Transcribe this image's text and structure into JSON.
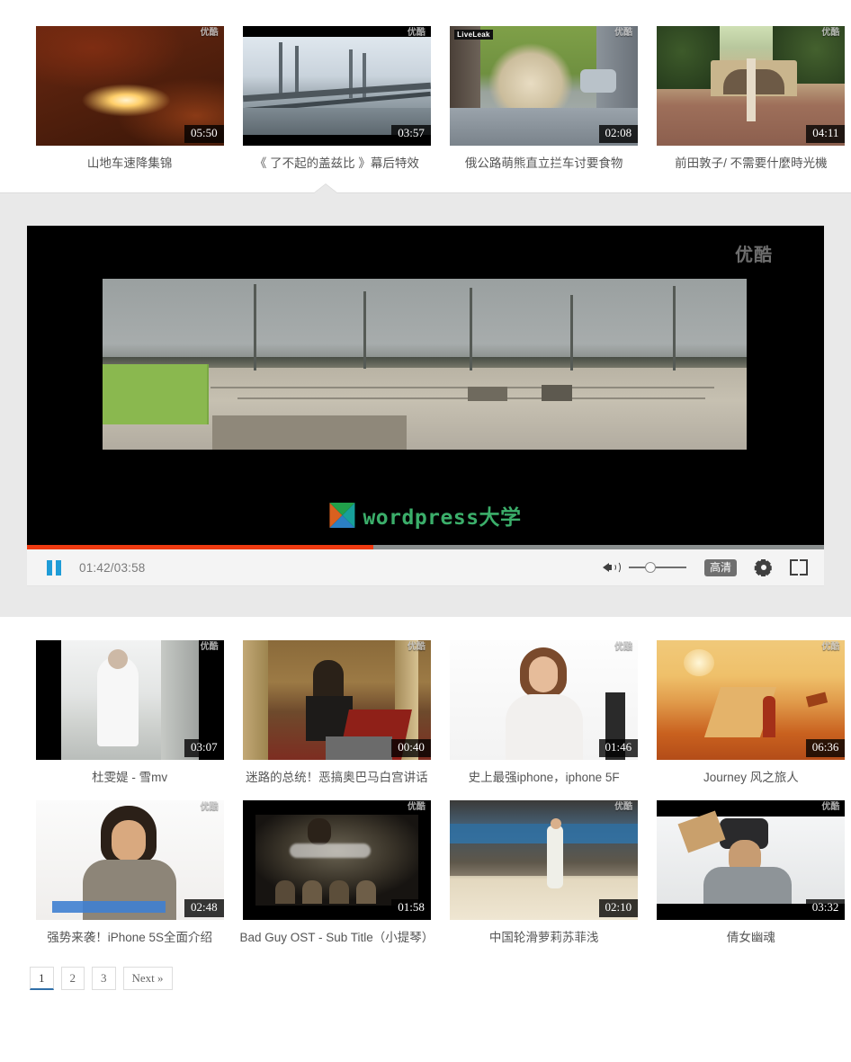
{
  "site": {
    "player_watermark": "优酷",
    "brand_watermark_text": "wordpress大学",
    "thumb_watermark": "优酷",
    "liveleak_badge": "LiveLeak"
  },
  "top_row": [
    {
      "title": "山地车速降集锦",
      "duration": "05:50",
      "watermark": "优酷",
      "active": false
    },
    {
      "title": "《 了不起的盖兹比 》幕后特效",
      "duration": "03:57",
      "watermark": "优酷",
      "active": true
    },
    {
      "title": "俄公路萌熊直立拦车讨要食物",
      "duration": "02:08",
      "watermark": "优酷",
      "badge": "LiveLeak",
      "active": false
    },
    {
      "title": "前田敦子/ 不需要什麼時光機",
      "duration": "04:11",
      "watermark": "优酷",
      "active": false
    }
  ],
  "player": {
    "watermark": "优酷",
    "brand": "wordpress大学",
    "time_display": "01:42/03:58",
    "current_time": "01:42",
    "total_time": "03:58",
    "progress_percent": 43.5,
    "volume_percent": 38,
    "quality_label": "高清",
    "pause_label": "pause",
    "state": "playing"
  },
  "bottom_row_1": [
    {
      "title": "杜雯媞 - 雪mv",
      "duration": "03:07",
      "watermark": "优酷"
    },
    {
      "title": "迷路的总统！恶搞奥巴马白宫讲话",
      "duration": "00:40",
      "watermark": "优酷"
    },
    {
      "title": "史上最强iphone，iphone 5F",
      "duration": "01:46",
      "watermark": "优酷"
    },
    {
      "title": "Journey 风之旅人",
      "duration": "06:36",
      "watermark": "优酷"
    }
  ],
  "bottom_row_2": [
    {
      "title": "强势来袭！iPhone 5S全面介绍",
      "duration": "02:48",
      "watermark": "优酷"
    },
    {
      "title": "Bad Guy OST - Sub Title（小提琴）",
      "duration": "01:58",
      "watermark": "优酷"
    },
    {
      "title": "中国轮滑萝莉苏菲浅",
      "duration": "02:10",
      "watermark": "优酷"
    },
    {
      "title": "倩女幽魂",
      "duration": "03:32",
      "watermark": "优酷"
    }
  ],
  "pagination": {
    "pages": [
      "1",
      "2",
      "3"
    ],
    "current": "1",
    "next_label": "Next »"
  },
  "colors": {
    "progress_fill": "#ef3a11",
    "progress_track": "#8a8f8f",
    "pause_blue": "#1e9cd7",
    "section_bg": "#e9e9e9",
    "title_text": "#555555",
    "page_active_underline": "#2f6fa8",
    "brand_green": "#3bae6a"
  }
}
